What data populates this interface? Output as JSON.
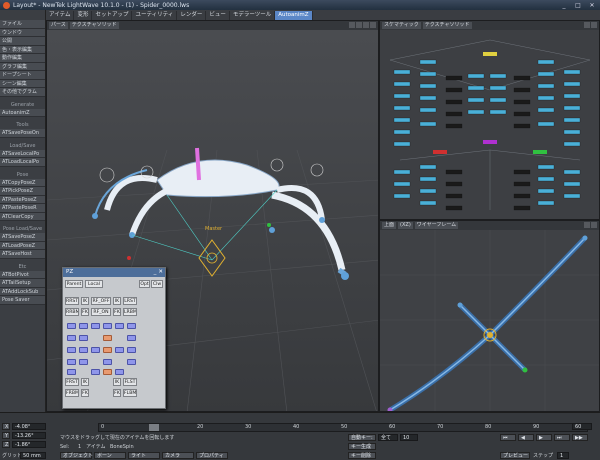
{
  "window": {
    "title": "Layout* - NewTek LightWave 10.1.0 - (1) - Spider_0000.lws",
    "controls": [
      "_",
      "□",
      "✕"
    ]
  },
  "menubar": {
    "items": [
      "ファイル",
      "ウンドウ",
      "アイテム",
      "変形",
      "セットアップ",
      "ユーティリティ",
      "レンダー",
      "ビュー",
      "モデラーツール",
      "AutoanimZ"
    ],
    "active": "AutoanimZ"
  },
  "leftpanel": {
    "top_buttons": [
      "ファイル",
      "ウンドウ",
      "公開",
      "色・表示編集",
      "動作編集",
      "グラフ編集",
      "ドープシート",
      "シーン編集",
      "その他でグラム"
    ],
    "sections": [
      {
        "header": "Generate",
        "buttons": [
          "AutoanimZ"
        ]
      },
      {
        "header": "Tools",
        "buttons": [
          "ATSavePoseOn"
        ]
      },
      {
        "header": "Load/Save",
        "buttons": [
          "ATSaveLocalPo",
          "ATLoadLocalPo"
        ]
      },
      {
        "header": "Pose",
        "buttons": [
          "ATCopyPoseZ",
          "ATPickPoseZ",
          "ATPastePoseZ",
          "ATPastePoseR",
          "ATClearCopy"
        ]
      },
      {
        "header": "Pose Load/Save",
        "buttons": [
          "ATSavePoseZ",
          "ATLoadPoseZ",
          "ATSaveHost"
        ]
      },
      {
        "header": "Etc",
        "buttons": [
          "ATBotPivot",
          "ATTailSetup",
          "ATAddLockSub",
          "Pose Saver"
        ]
      }
    ]
  },
  "viewports": {
    "perspective": {
      "mode": "パース",
      "shading": "テクスチャソリッド"
    },
    "schematic": {
      "mode": "スケマティック",
      "shading": "テクスチャソリッド"
    },
    "top": {
      "mode": "上面",
      "zoom": "(XZ)",
      "shading": "ワイヤーフレーム"
    },
    "bone_label": "Master"
  },
  "floatpanel": {
    "title": "PZ",
    "tabs": [
      "Parent",
      "Local"
    ],
    "right_tabs": [
      "Opt",
      "Clw"
    ],
    "buttons": [
      "RRST",
      "IK",
      "RF_OFF",
      "IK",
      "LRST",
      "RRBM",
      "FK",
      "RF_ON",
      "FK",
      "LRBM",
      "FRST",
      "IK",
      "IK",
      "FLST",
      "FRBM",
      "FK",
      "FK",
      "FLBM"
    ]
  },
  "timeline": {
    "rows": [
      {
        "axis": "X",
        "value": "-4.08°"
      },
      {
        "axis": "Y",
        "value": "-13.26°"
      },
      {
        "axis": "Z",
        "value": "-1.86°"
      }
    ],
    "grid_label": "グリッド",
    "grid_value": "50 mm",
    "ticks": [
      "0",
      "10",
      "20",
      "30",
      "40",
      "50",
      "60",
      "70",
      "80",
      "90",
      "100"
    ],
    "current_frame": "10",
    "status_text": "マウスをドラッグして現在のアイテムを回転します",
    "status_row2": [
      "Sel:",
      "1",
      "アイテム",
      "BoneSpin"
    ],
    "bottom_buttons": [
      "オブジェクト",
      "ボーン",
      "ライト",
      "カメラ",
      "プロパティ"
    ],
    "autokey": "自動キー:",
    "autokey_value": "全て",
    "create_key": "キー生成",
    "delete_key": "キー削除",
    "preview": "プレビュー",
    "step_label": "ステップ",
    "step_value": "1",
    "end_frame": "60",
    "cur_value": "10"
  }
}
